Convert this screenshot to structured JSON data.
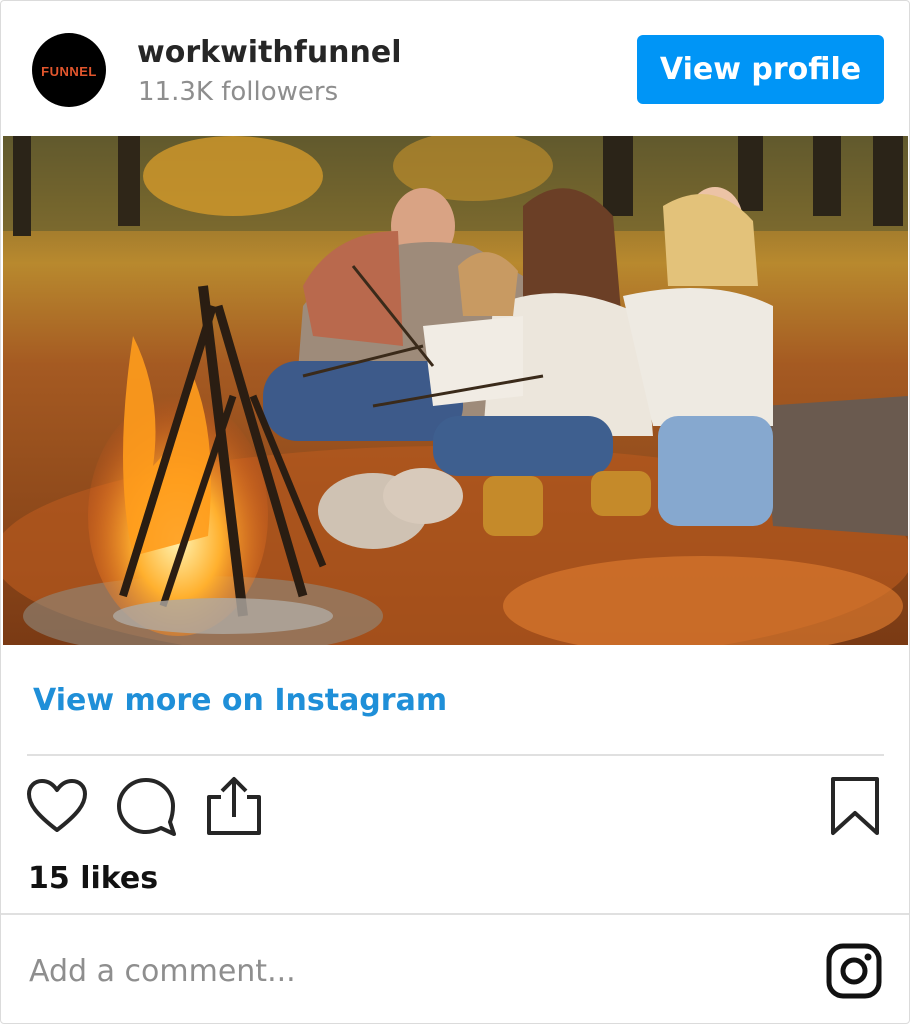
{
  "account": {
    "avatar_text": "FUNNEL",
    "username": "workwithfunnel",
    "followers": "11.3K followers"
  },
  "header": {
    "view_profile_label": "View profile"
  },
  "post": {
    "image_subject": "family-campfire-autumn-photo",
    "view_more_label": "View more on Instagram",
    "likes": "15 likes"
  },
  "actions": {
    "like_icon": "heart-icon",
    "comment_icon": "comment-icon",
    "share_icon": "share-icon",
    "save_icon": "bookmark-icon"
  },
  "comment": {
    "placeholder": "Add a comment..."
  },
  "brand": {
    "logo_icon": "instagram-icon"
  },
  "colors": {
    "accent": "#0095f6",
    "link": "#1f8fd8",
    "muted": "#8e8e8e"
  }
}
